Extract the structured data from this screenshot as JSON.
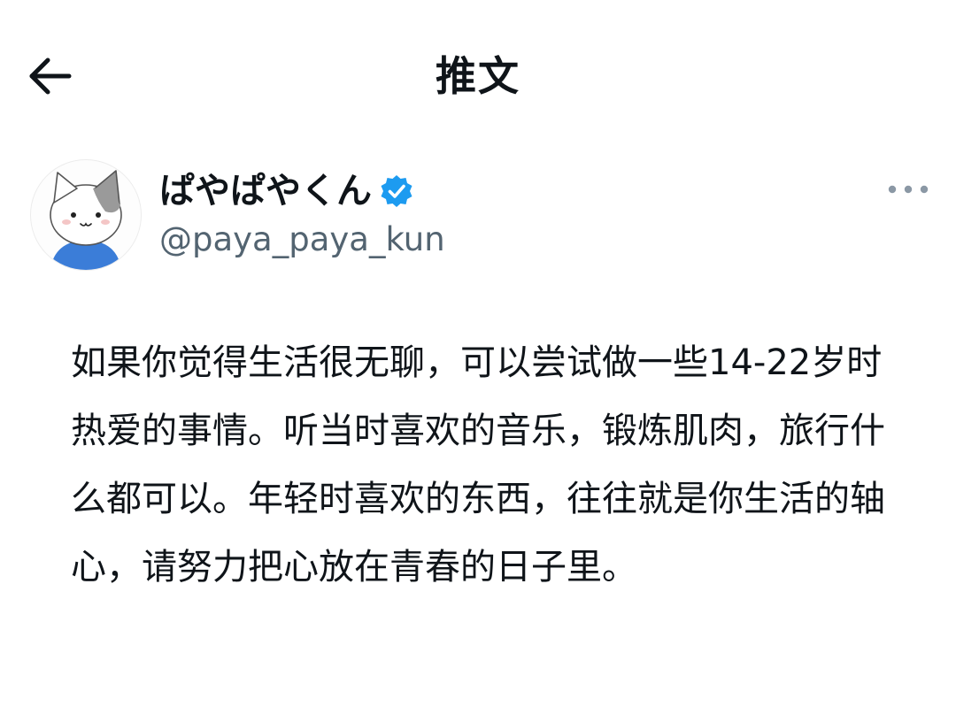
{
  "header": {
    "title": "推文",
    "back_icon": "arrow-left-icon"
  },
  "author": {
    "display_name": "ぱやぱやくん",
    "username": "@paya_paya_kun",
    "verified": true,
    "verified_icon": "verified-badge-icon",
    "verified_color": "#1d9bf0",
    "more_icon": "more-horizontal-icon",
    "avatar_icon": "cat-avatar-icon"
  },
  "tweet": {
    "text": "如果你觉得生活很无聊，可以尝试做一些14-22岁时热爱的事情。听当时喜欢的音乐，锻炼肌肉，旅行什么都可以。年轻时喜欢的东西，往往就是你生活的轴心，请努力把心放在青春的日子里。"
  },
  "colors": {
    "text_primary": "#0f1419",
    "text_secondary": "#536471",
    "background": "#ffffff"
  }
}
